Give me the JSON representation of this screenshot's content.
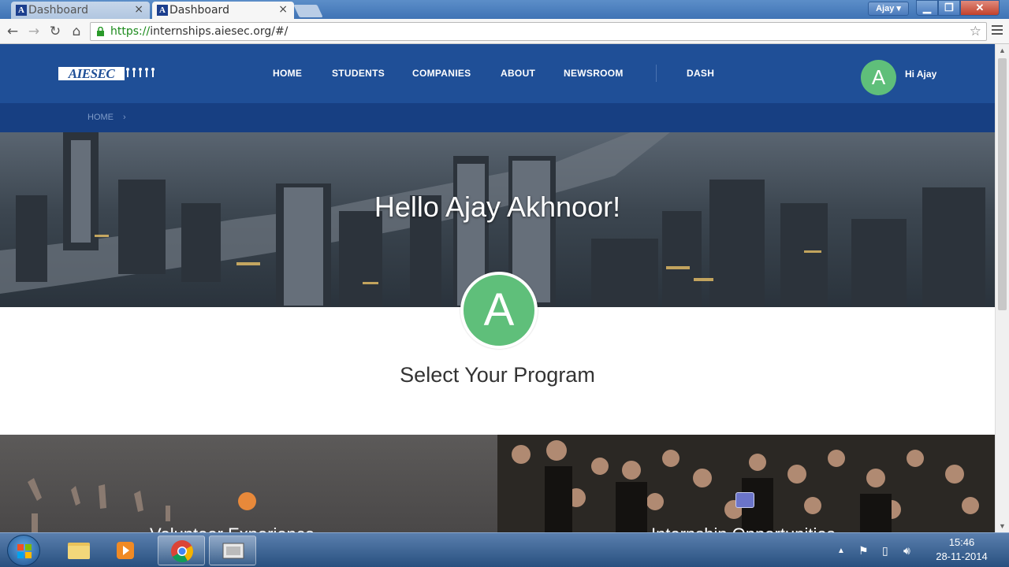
{
  "browser": {
    "tabs": [
      {
        "title": "Dashboard",
        "favicon_letter": "A"
      },
      {
        "title": "Dashboard",
        "favicon_letter": "A"
      }
    ],
    "user_button": "Ajay",
    "url_scheme": "https://",
    "url_rest": "internships.aiesec.org/#/"
  },
  "site": {
    "logo_text": "AIESEC",
    "nav": [
      "HOME",
      "STUDENTS",
      "COMPANIES",
      "ABOUT",
      "NEWSROOM",
      "DASH"
    ],
    "avatar_letter": "A",
    "greeting": "Hi Ajay",
    "breadcrumb": "HOME",
    "breadcrumb_chevron": "›",
    "hero_title": "Hello Ajay Akhnoor!",
    "profile_letter": "A",
    "section_title": "Select Your Program",
    "programs": [
      {
        "title": "Volunteer Experience",
        "icon": "globe-icon"
      },
      {
        "title": "Internship Opportunities",
        "icon": "contact-card-icon"
      }
    ],
    "colors": {
      "header": "#1f4f97",
      "breadcrumb_bar": "#173f82",
      "avatar": "#5fbf7a"
    }
  },
  "taskbar": {
    "pinned": [
      "explorer-icon",
      "media-player-icon",
      "chrome-icon",
      "presentation-icon"
    ],
    "time": "15:46",
    "date": "28-11-2014"
  }
}
